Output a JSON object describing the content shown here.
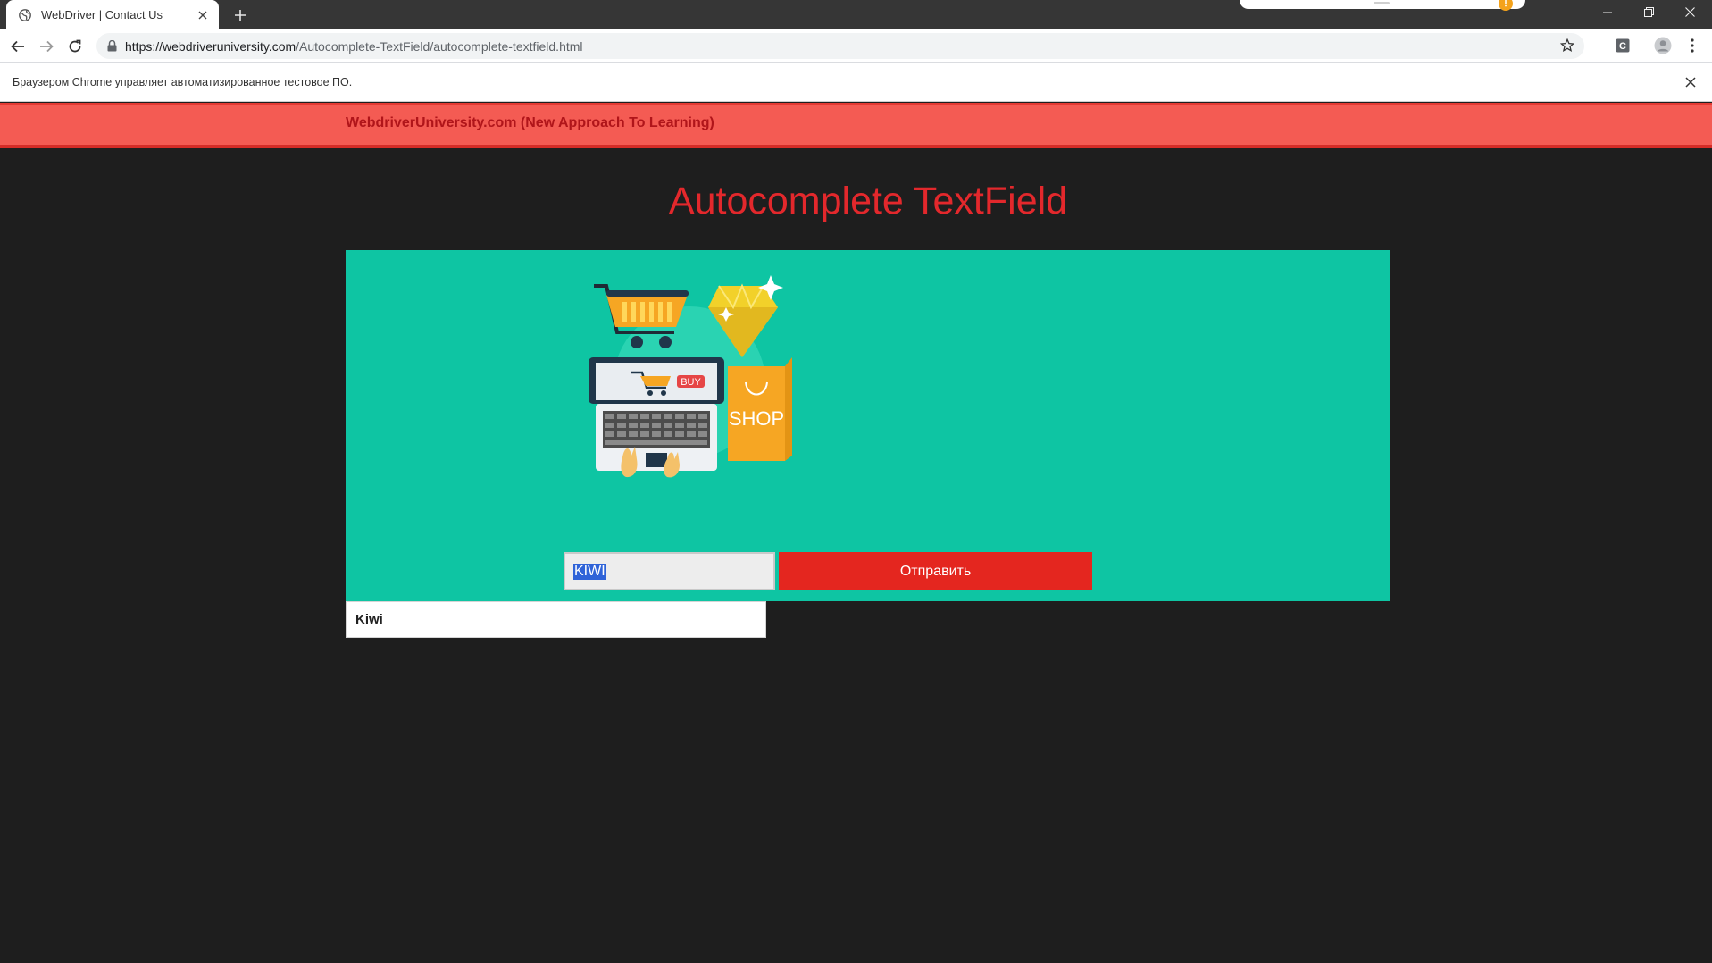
{
  "browser": {
    "tab": {
      "title": "WebDriver | Contact Us"
    },
    "omnibox": {
      "url_host": "https://webdriveruniversity.com",
      "url_path": "/Autocomplete-TextField/autocomplete-textfield.html"
    },
    "infobar": {
      "message": "Браузером Chrome управляет автоматизированное тестовое ПО."
    },
    "extension_badge": "C"
  },
  "page": {
    "brand": "WebdriverUniversity.com (New Approach To Learning)",
    "heading": "Autocomplete TextField",
    "illustration": {
      "buy_label": "BUY",
      "shop_label": "SHOP"
    },
    "input": {
      "value": "KIWI"
    },
    "submit_label": "Отправить",
    "suggestions": [
      "Kiwi"
    ]
  },
  "colors": {
    "banner": "#f45b53",
    "brand_text": "#b0151a",
    "heading": "#e3282c",
    "panel": "#0ec5a3",
    "submit": "#e4261f",
    "page_background": "#1e1e1e"
  }
}
